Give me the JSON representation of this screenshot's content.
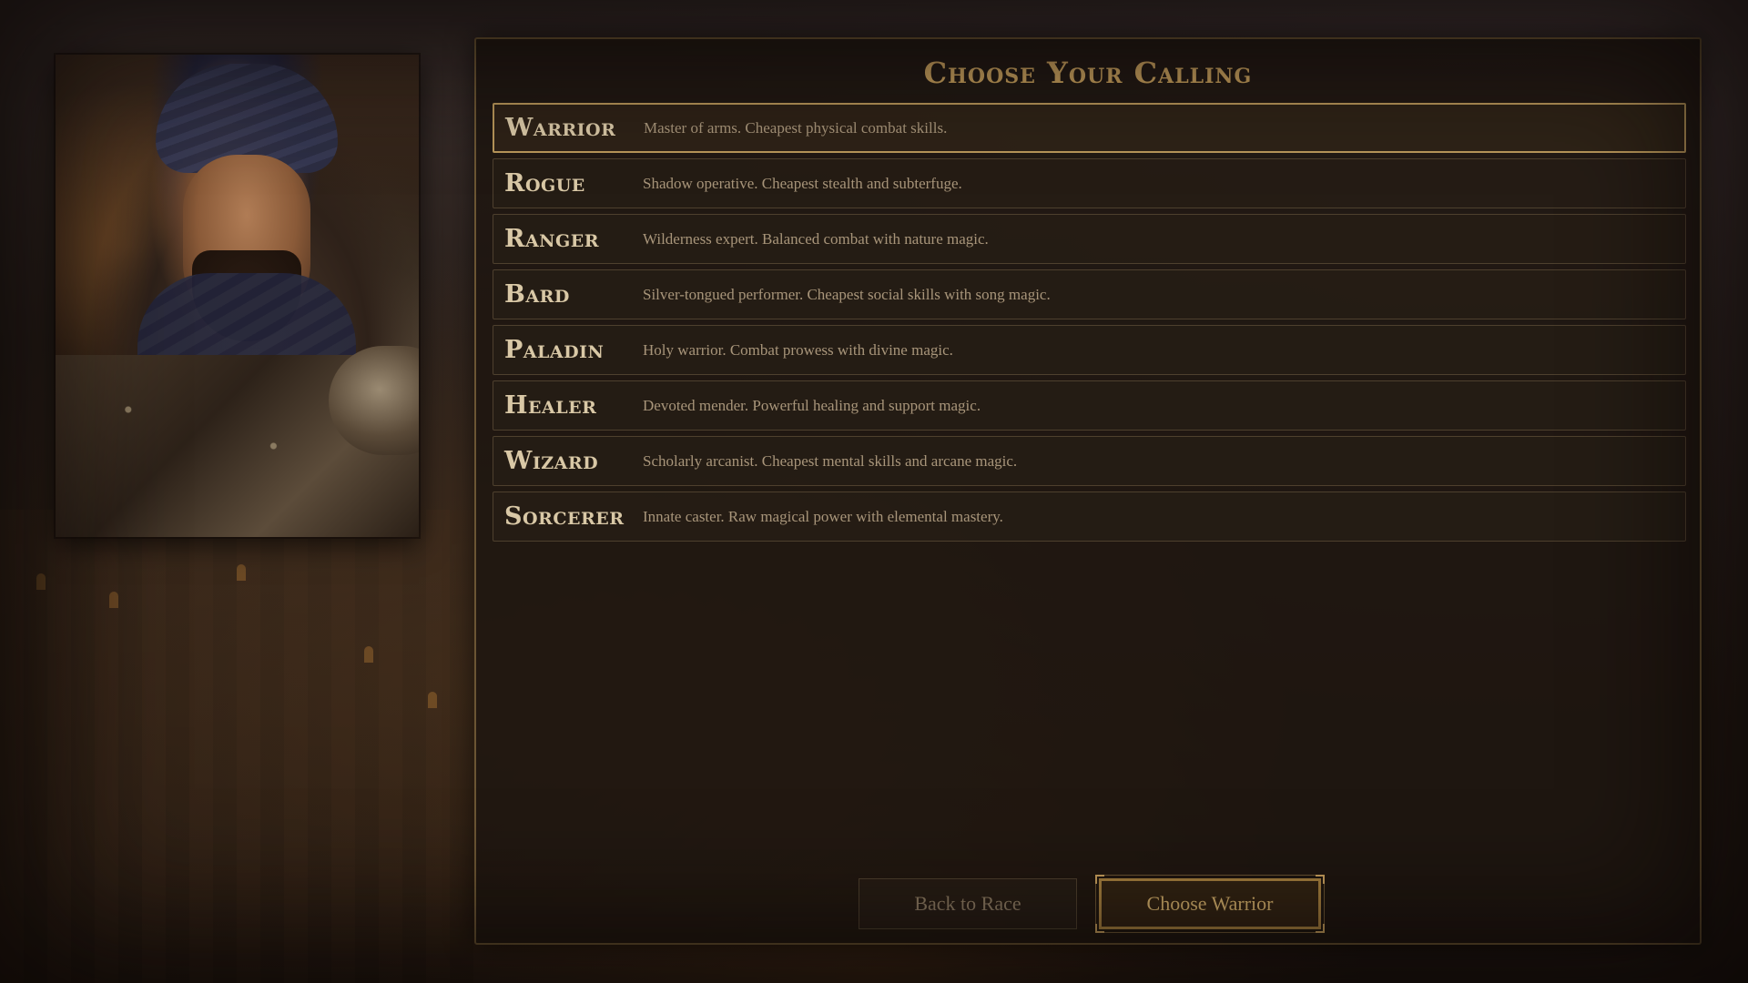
{
  "screen": {
    "title": "Choose Your Calling"
  },
  "classes": [
    {
      "name": "Warrior",
      "description": "Master of arms. Cheapest physical combat skills.",
      "selected": true
    },
    {
      "name": "Rogue",
      "description": "Shadow operative. Cheapest stealth and subterfuge.",
      "selected": false
    },
    {
      "name": "Ranger",
      "description": "Wilderness expert. Balanced combat with nature magic.",
      "selected": false
    },
    {
      "name": "Bard",
      "description": "Silver-tongued performer. Cheapest social skills with song magic.",
      "selected": false
    },
    {
      "name": "Paladin",
      "description": "Holy warrior. Combat prowess with divine magic.",
      "selected": false
    },
    {
      "name": "Healer",
      "description": "Devoted mender. Powerful healing and support magic.",
      "selected": false
    },
    {
      "name": "Wizard",
      "description": "Scholarly arcanist. Cheapest mental skills and arcane magic.",
      "selected": false
    },
    {
      "name": "Sorcerer",
      "description": "Innate caster. Raw magical power with elemental mastery.",
      "selected": false
    }
  ],
  "buttons": {
    "back_label": "Back to Race",
    "choose_label": "Choose Warrior"
  },
  "colors": {
    "accent_gold": "#c9a15e",
    "panel_border": "#6b5533",
    "panel_bg": "#1e1610"
  }
}
